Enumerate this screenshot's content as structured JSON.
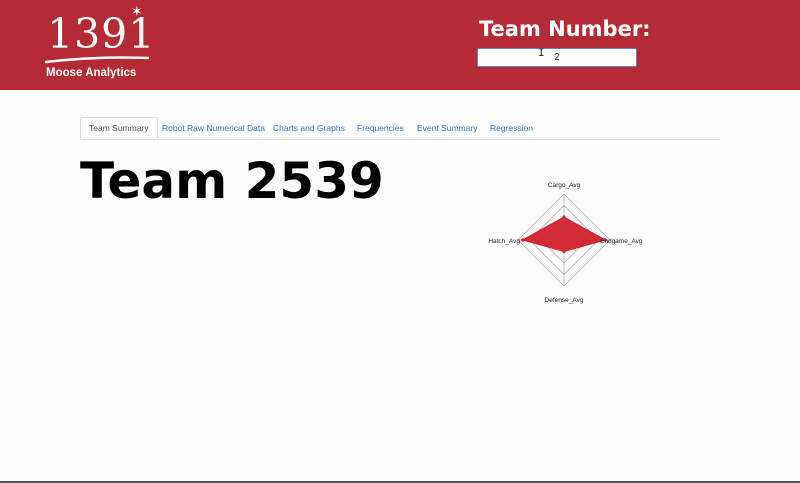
{
  "header": {
    "logo_number": "1391",
    "logo_subtitle": "Moose Analytics",
    "team_number_label": "Team Number:",
    "team_number_value": "2",
    "brand_color": "#b32b37"
  },
  "tabs": [
    {
      "label": "Team Summary",
      "active": true
    },
    {
      "label": "Robot Raw Numerical Data",
      "active": false
    },
    {
      "label": "Charts and Graphs",
      "active": false
    },
    {
      "label": "Frequencies",
      "active": false
    },
    {
      "label": "Event Summary",
      "active": false
    },
    {
      "label": "Regression",
      "active": false
    }
  ],
  "main": {
    "team_title": "Team 2539"
  },
  "chart_data": {
    "type": "radar",
    "axes": [
      "Cargo_Avg",
      "Endgame_Avg",
      "Defense_Avg",
      "Hatch_Avg"
    ],
    "values": [
      0.5,
      0.9,
      0.25,
      0.9
    ],
    "range": [
      0,
      1
    ],
    "rings": 4,
    "fill_color": "#d0222c"
  }
}
